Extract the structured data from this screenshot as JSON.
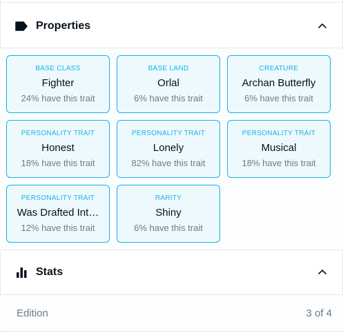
{
  "properties": {
    "title": "Properties",
    "traits": [
      {
        "type": "BASE CLASS",
        "value": "Fighter",
        "rarity": "24% have this trait"
      },
      {
        "type": "BASE LAND",
        "value": "Orlal",
        "rarity": "6% have this trait"
      },
      {
        "type": "CREATURE",
        "value": "Archan Butterfly",
        "rarity": "6% have this trait"
      },
      {
        "type": "PERSONALITY TRAIT",
        "value": "Honest",
        "rarity": "18% have this trait"
      },
      {
        "type": "PERSONALITY TRAIT",
        "value": "Lonely",
        "rarity": "82% have this trait"
      },
      {
        "type": "PERSONALITY TRAIT",
        "value": "Musical",
        "rarity": "18% have this trait"
      },
      {
        "type": "PERSONALITY TRAIT",
        "value": "Was Drafted Int…",
        "rarity": "12% have this trait"
      },
      {
        "type": "RARITY",
        "value": "Shiny",
        "rarity": "6% have this trait"
      }
    ]
  },
  "stats": {
    "title": "Stats",
    "rows": [
      {
        "label": "Edition",
        "value": "3 of 4"
      }
    ]
  },
  "icons": {
    "properties": "label-tag-icon",
    "stats": "bar-chart-icon",
    "collapse": "chevron-up-icon"
  },
  "colors": {
    "accent": "#15b2e5",
    "trait_bg": "#eef9fe",
    "text_primary": "#04111d",
    "text_secondary": "#707a83",
    "border": "#e5e8eb"
  }
}
